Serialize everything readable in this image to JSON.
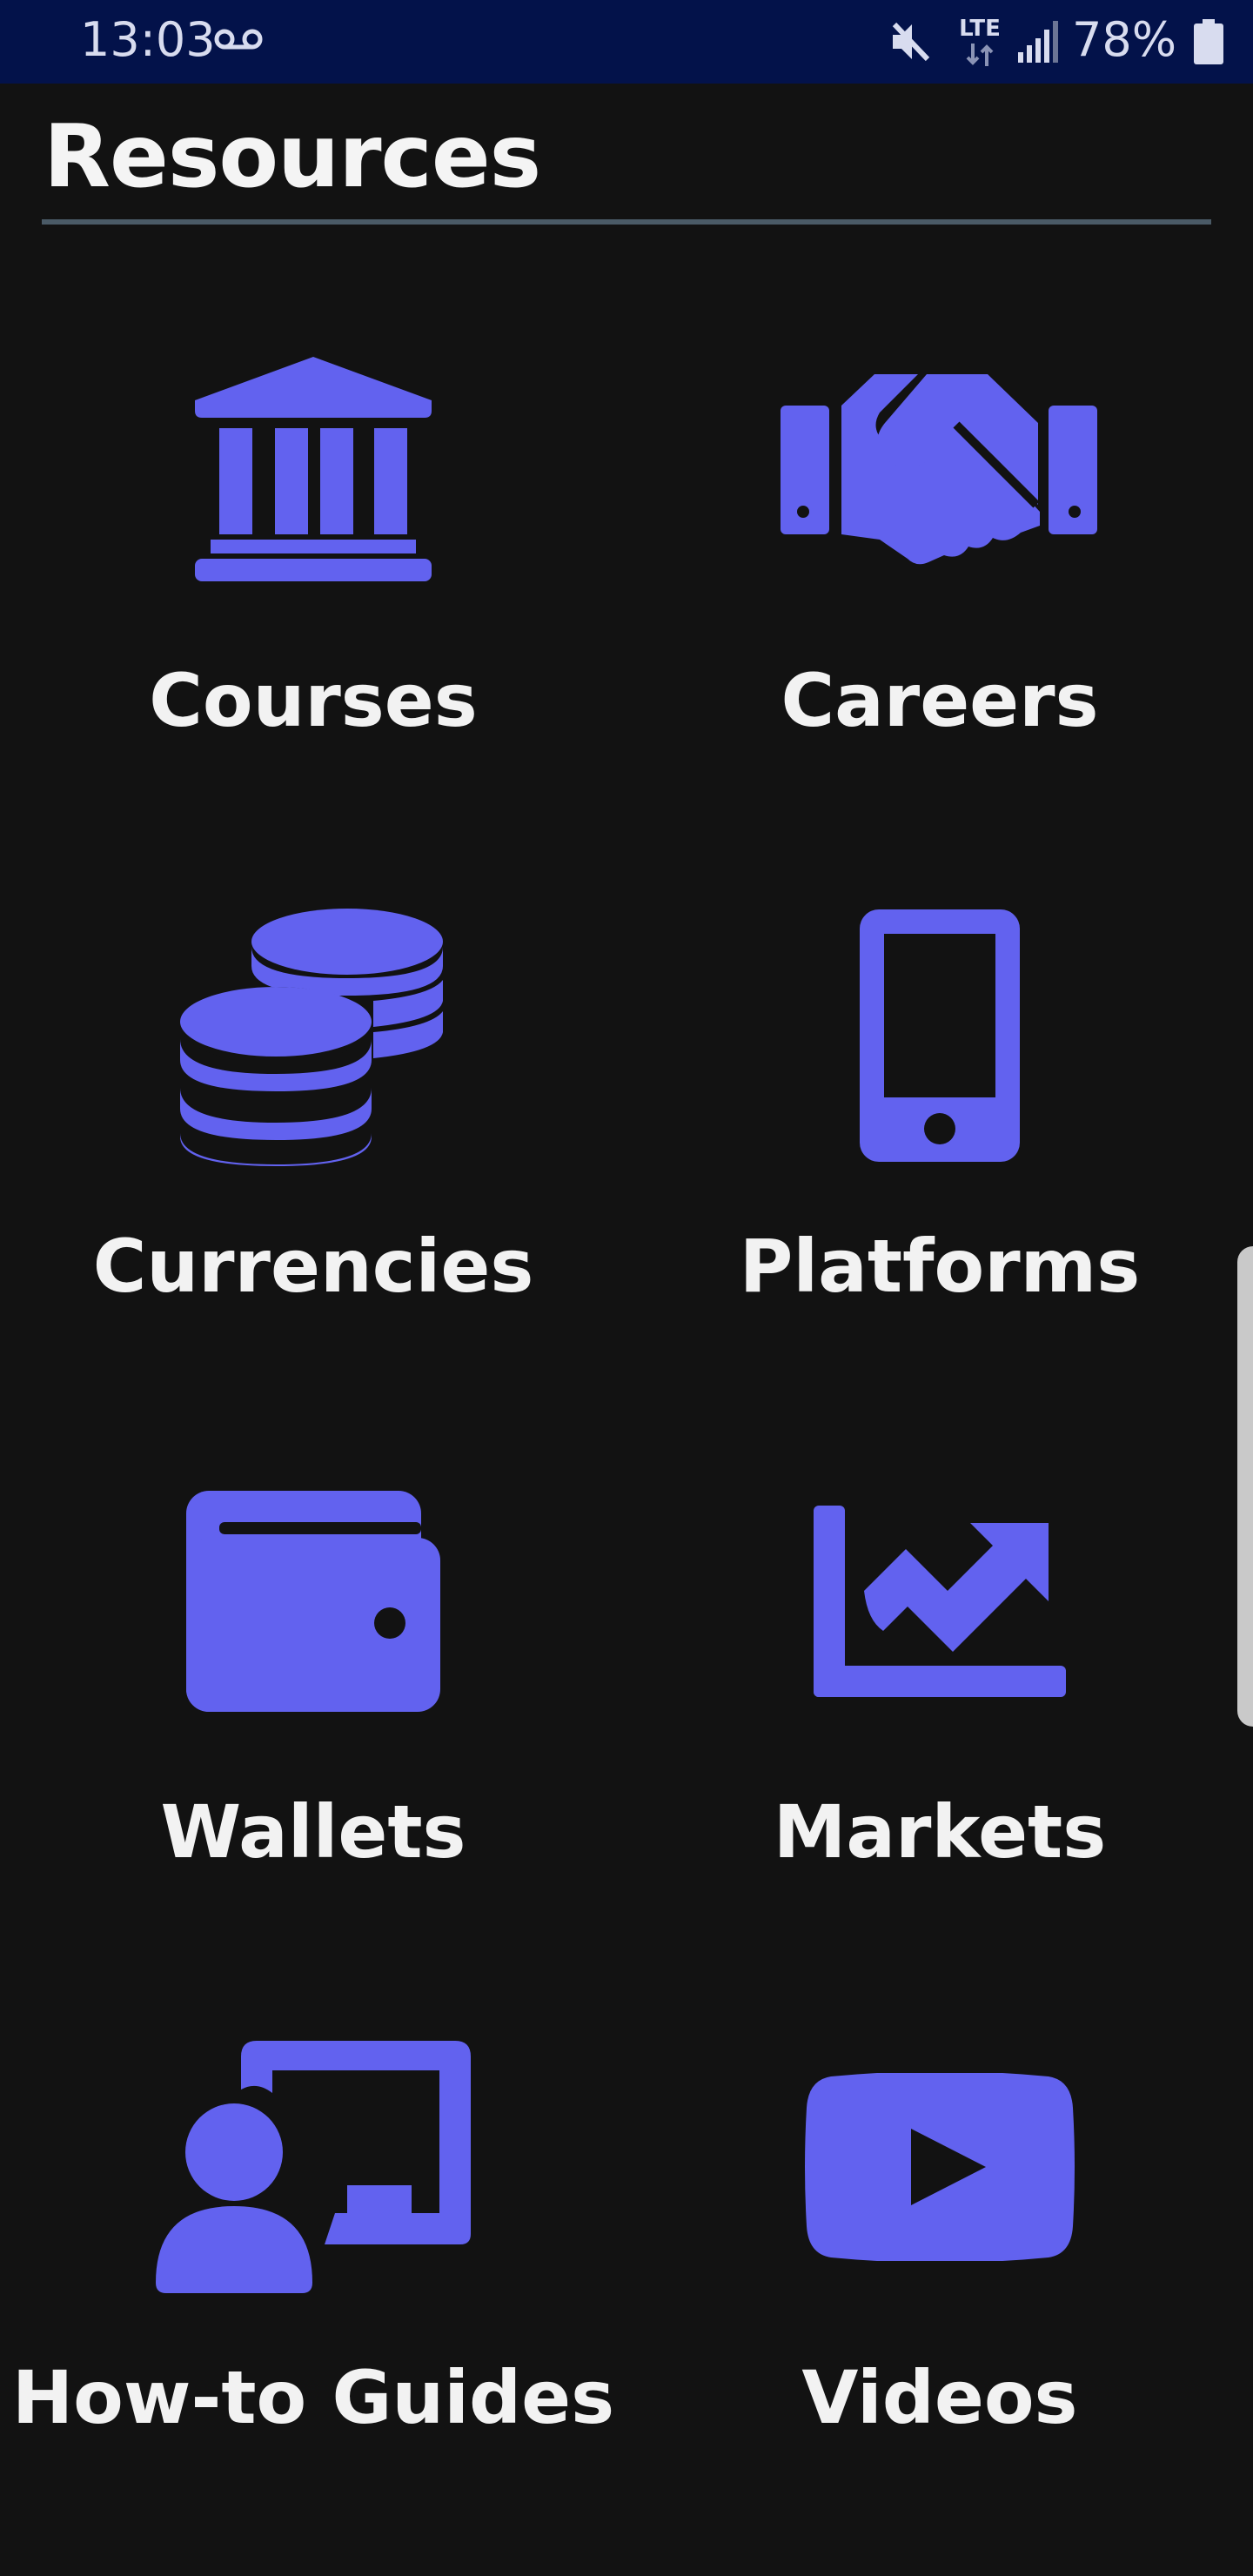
{
  "status_bar": {
    "time": "13:03",
    "network": "LTE",
    "battery": "78%",
    "icons": [
      "voicemail-icon",
      "mute-icon",
      "lte-icon",
      "signal-icon",
      "battery-icon"
    ]
  },
  "header": {
    "title": "Resources"
  },
  "colors": {
    "accent": "#6262ef",
    "background": "#121212",
    "status_bar": "#03124a",
    "divider": "#4a5a66"
  },
  "resources": [
    {
      "label": "Courses",
      "icon": "bank-icon"
    },
    {
      "label": "Careers",
      "icon": "handshake-icon"
    },
    {
      "label": "Currencies",
      "icon": "coins-icon"
    },
    {
      "label": "Platforms",
      "icon": "smartphone-icon"
    },
    {
      "label": "Wallets",
      "icon": "wallet-icon"
    },
    {
      "label": "Markets",
      "icon": "trending-up-chart-icon"
    },
    {
      "label": "How-to Guides",
      "icon": "teacher-board-icon"
    },
    {
      "label": "Videos",
      "icon": "play-video-icon"
    }
  ]
}
